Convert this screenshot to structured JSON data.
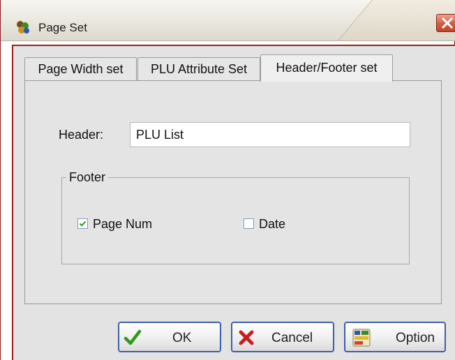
{
  "window": {
    "title": "Page Set"
  },
  "tabs": [
    {
      "label": "Page Width set",
      "active": false
    },
    {
      "label": "PLU Attribute Set",
      "active": false
    },
    {
      "label": "Header/Footer set",
      "active": true
    }
  ],
  "header_field": {
    "label": "Header:",
    "value": "PLU List"
  },
  "footer": {
    "legend": "Footer",
    "page_num": {
      "label": "Page Num",
      "checked": true
    },
    "date": {
      "label": "Date",
      "checked": false
    }
  },
  "buttons": {
    "ok": "OK",
    "cancel": "Cancel",
    "option": "Option"
  },
  "icons": {
    "app": "app-icon",
    "close": "close-icon",
    "ok": "check-icon",
    "cancel": "x-icon",
    "option": "option-icon"
  },
  "colors": {
    "close_button": "#d45a3c",
    "ok_check": "#2e9a1e",
    "cancel_x": "#c81e1e",
    "button_border": "#3c5fa8",
    "frame_border": "#9b1f1f"
  }
}
